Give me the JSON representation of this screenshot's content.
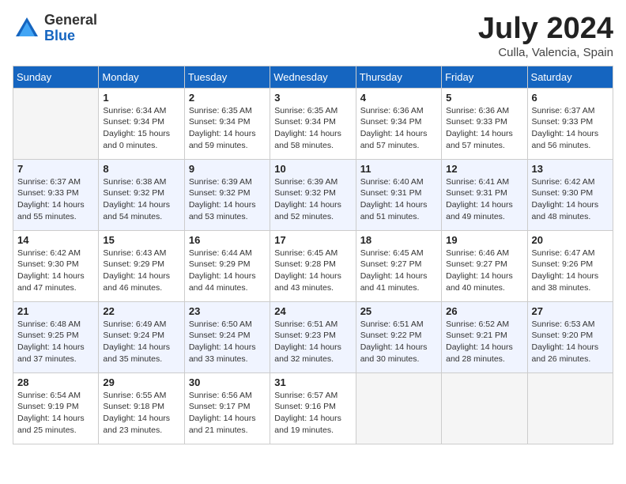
{
  "header": {
    "logo_general": "General",
    "logo_blue": "Blue",
    "month_year": "July 2024",
    "location": "Culla, Valencia, Spain"
  },
  "weekdays": [
    "Sunday",
    "Monday",
    "Tuesday",
    "Wednesday",
    "Thursday",
    "Friday",
    "Saturday"
  ],
  "weeks": [
    [
      {
        "day": "",
        "info": ""
      },
      {
        "day": "1",
        "info": "Sunrise: 6:34 AM\nSunset: 9:34 PM\nDaylight: 15 hours\nand 0 minutes."
      },
      {
        "day": "2",
        "info": "Sunrise: 6:35 AM\nSunset: 9:34 PM\nDaylight: 14 hours\nand 59 minutes."
      },
      {
        "day": "3",
        "info": "Sunrise: 6:35 AM\nSunset: 9:34 PM\nDaylight: 14 hours\nand 58 minutes."
      },
      {
        "day": "4",
        "info": "Sunrise: 6:36 AM\nSunset: 9:34 PM\nDaylight: 14 hours\nand 57 minutes."
      },
      {
        "day": "5",
        "info": "Sunrise: 6:36 AM\nSunset: 9:33 PM\nDaylight: 14 hours\nand 57 minutes."
      },
      {
        "day": "6",
        "info": "Sunrise: 6:37 AM\nSunset: 9:33 PM\nDaylight: 14 hours\nand 56 minutes."
      }
    ],
    [
      {
        "day": "7",
        "info": "Sunrise: 6:37 AM\nSunset: 9:33 PM\nDaylight: 14 hours\nand 55 minutes."
      },
      {
        "day": "8",
        "info": "Sunrise: 6:38 AM\nSunset: 9:32 PM\nDaylight: 14 hours\nand 54 minutes."
      },
      {
        "day": "9",
        "info": "Sunrise: 6:39 AM\nSunset: 9:32 PM\nDaylight: 14 hours\nand 53 minutes."
      },
      {
        "day": "10",
        "info": "Sunrise: 6:39 AM\nSunset: 9:32 PM\nDaylight: 14 hours\nand 52 minutes."
      },
      {
        "day": "11",
        "info": "Sunrise: 6:40 AM\nSunset: 9:31 PM\nDaylight: 14 hours\nand 51 minutes."
      },
      {
        "day": "12",
        "info": "Sunrise: 6:41 AM\nSunset: 9:31 PM\nDaylight: 14 hours\nand 49 minutes."
      },
      {
        "day": "13",
        "info": "Sunrise: 6:42 AM\nSunset: 9:30 PM\nDaylight: 14 hours\nand 48 minutes."
      }
    ],
    [
      {
        "day": "14",
        "info": "Sunrise: 6:42 AM\nSunset: 9:30 PM\nDaylight: 14 hours\nand 47 minutes."
      },
      {
        "day": "15",
        "info": "Sunrise: 6:43 AM\nSunset: 9:29 PM\nDaylight: 14 hours\nand 46 minutes."
      },
      {
        "day": "16",
        "info": "Sunrise: 6:44 AM\nSunset: 9:29 PM\nDaylight: 14 hours\nand 44 minutes."
      },
      {
        "day": "17",
        "info": "Sunrise: 6:45 AM\nSunset: 9:28 PM\nDaylight: 14 hours\nand 43 minutes."
      },
      {
        "day": "18",
        "info": "Sunrise: 6:45 AM\nSunset: 9:27 PM\nDaylight: 14 hours\nand 41 minutes."
      },
      {
        "day": "19",
        "info": "Sunrise: 6:46 AM\nSunset: 9:27 PM\nDaylight: 14 hours\nand 40 minutes."
      },
      {
        "day": "20",
        "info": "Sunrise: 6:47 AM\nSunset: 9:26 PM\nDaylight: 14 hours\nand 38 minutes."
      }
    ],
    [
      {
        "day": "21",
        "info": "Sunrise: 6:48 AM\nSunset: 9:25 PM\nDaylight: 14 hours\nand 37 minutes."
      },
      {
        "day": "22",
        "info": "Sunrise: 6:49 AM\nSunset: 9:24 PM\nDaylight: 14 hours\nand 35 minutes."
      },
      {
        "day": "23",
        "info": "Sunrise: 6:50 AM\nSunset: 9:24 PM\nDaylight: 14 hours\nand 33 minutes."
      },
      {
        "day": "24",
        "info": "Sunrise: 6:51 AM\nSunset: 9:23 PM\nDaylight: 14 hours\nand 32 minutes."
      },
      {
        "day": "25",
        "info": "Sunrise: 6:51 AM\nSunset: 9:22 PM\nDaylight: 14 hours\nand 30 minutes."
      },
      {
        "day": "26",
        "info": "Sunrise: 6:52 AM\nSunset: 9:21 PM\nDaylight: 14 hours\nand 28 minutes."
      },
      {
        "day": "27",
        "info": "Sunrise: 6:53 AM\nSunset: 9:20 PM\nDaylight: 14 hours\nand 26 minutes."
      }
    ],
    [
      {
        "day": "28",
        "info": "Sunrise: 6:54 AM\nSunset: 9:19 PM\nDaylight: 14 hours\nand 25 minutes."
      },
      {
        "day": "29",
        "info": "Sunrise: 6:55 AM\nSunset: 9:18 PM\nDaylight: 14 hours\nand 23 minutes."
      },
      {
        "day": "30",
        "info": "Sunrise: 6:56 AM\nSunset: 9:17 PM\nDaylight: 14 hours\nand 21 minutes."
      },
      {
        "day": "31",
        "info": "Sunrise: 6:57 AM\nSunset: 9:16 PM\nDaylight: 14 hours\nand 19 minutes."
      },
      {
        "day": "",
        "info": ""
      },
      {
        "day": "",
        "info": ""
      },
      {
        "day": "",
        "info": ""
      }
    ]
  ]
}
